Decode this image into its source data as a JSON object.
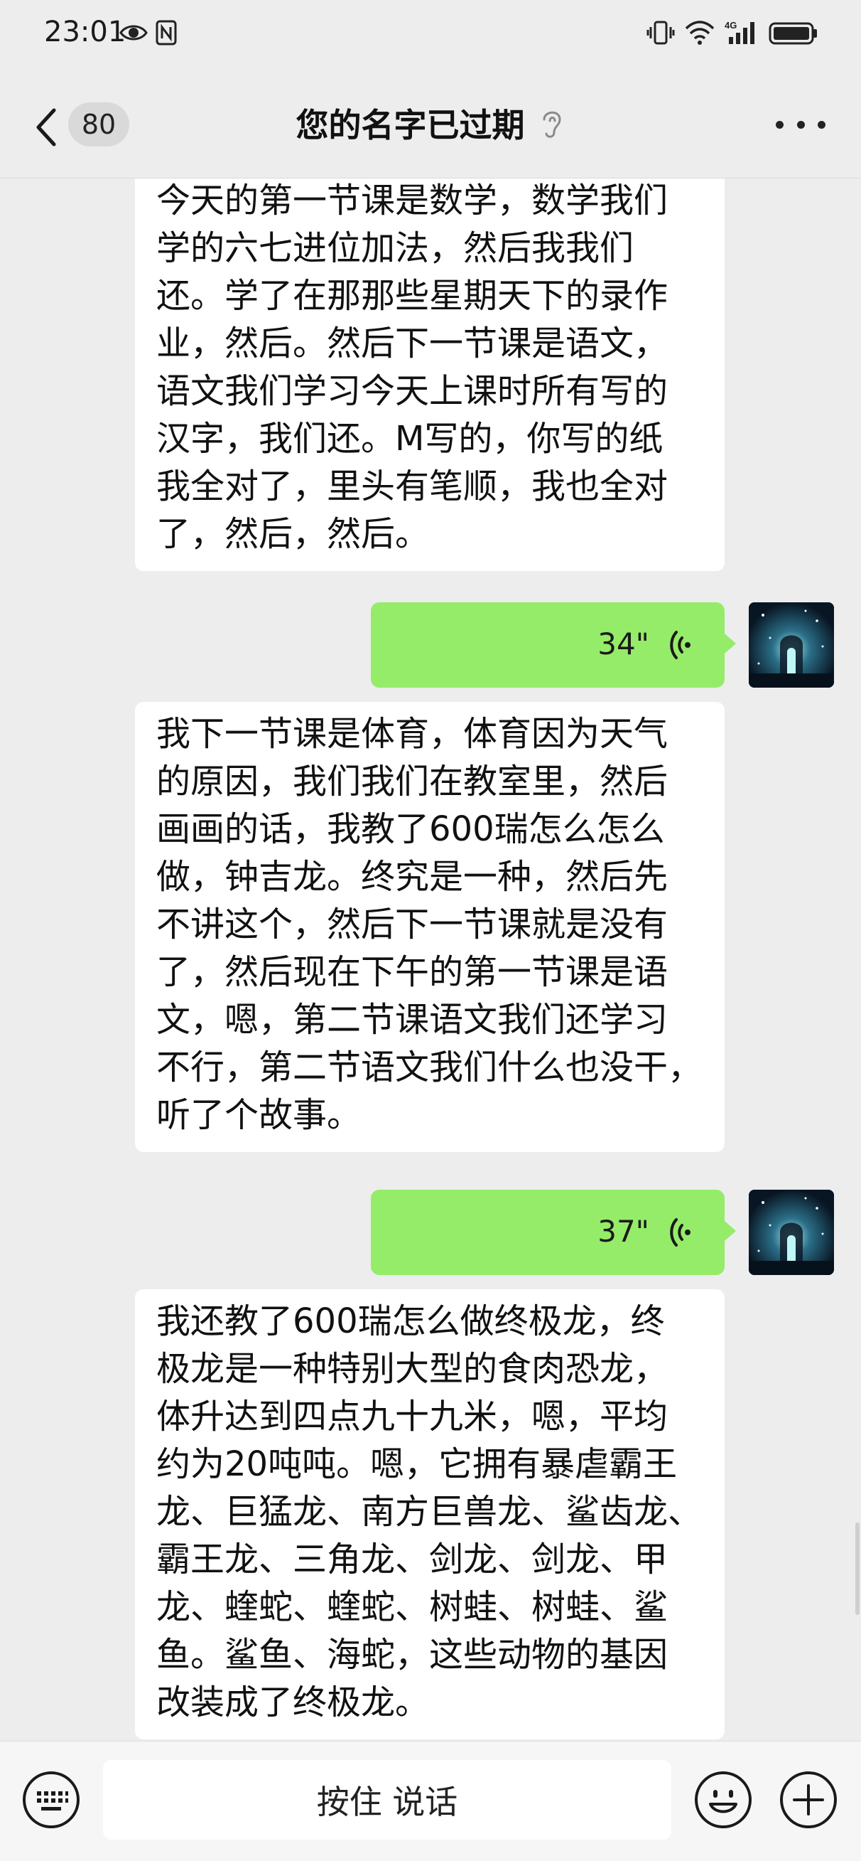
{
  "status_bar": {
    "time": "23:01",
    "left_icons": [
      "eye-icon",
      "nfc-icon"
    ],
    "right_icons": [
      "vibrate-icon",
      "wifi-icon",
      "signal-4g-icon",
      "battery-icon"
    ],
    "network_label": "4G"
  },
  "header": {
    "back_icon": "chevron-left-icon",
    "unread_count": "80",
    "title": "您的名字已过期",
    "title_icon": "ear-icon",
    "more_icon": "more-dots-icon"
  },
  "messages": [
    {
      "type": "text",
      "side": "left",
      "text": "今天的第一节课是数学，数学我们\n学的六七进位加法，然后我我们\n还。学了在那那些星期天下的录作\n业，然后。然后下一节课是语文，\n语文我们学习今天上课时所有写的\n汉字，我们还。M写的，你写的纸\n我全对了，里头有笔顺，我也全对\n了，然后，然后。"
    },
    {
      "type": "voice",
      "side": "right",
      "duration": "34\""
    },
    {
      "type": "text",
      "side": "left",
      "text": "我下一节课是体育，体育因为天气\n的原因，我们我们在教室里，然后\n画画的话，我教了600瑞怎么怎么\n做，钟吉龙。终究是一种，然后先\n不讲这个，然后下一节课就是没有\n了，然后现在下午的第一节课是语\n文，嗯，第二节课语文我们还学习\n不行，第二节语文我们什么也没干，\n听了个故事。"
    },
    {
      "type": "voice",
      "side": "right",
      "duration": "37\""
    },
    {
      "type": "text",
      "side": "left",
      "text": "我还教了600瑞怎么做终极龙，终\n极龙是一种特别大型的食肉恐龙，\n体升达到四点九十九米，嗯，平均\n约为20吨吨。嗯，它拥有暴虐霸王\n龙、巨猛龙、南方巨兽龙、鲨齿龙、\n霸王龙、三角龙、剑龙、剑龙、甲\n龙、蝰蛇、蝰蛇、树蛙、树蛙、鲨\n鱼。鲨鱼、海蛇，这些动物的基因\n改装成了终极龙。"
    }
  ],
  "input_bar": {
    "keyboard_icon": "keyboard-icon",
    "hold_to_talk": "按住 说话",
    "emoji_icon": "emoji-icon",
    "plus_icon": "plus-icon"
  },
  "colors": {
    "background": "#ededed",
    "voice_bubble": "#95ec69",
    "text_bubble": "#ffffff"
  }
}
